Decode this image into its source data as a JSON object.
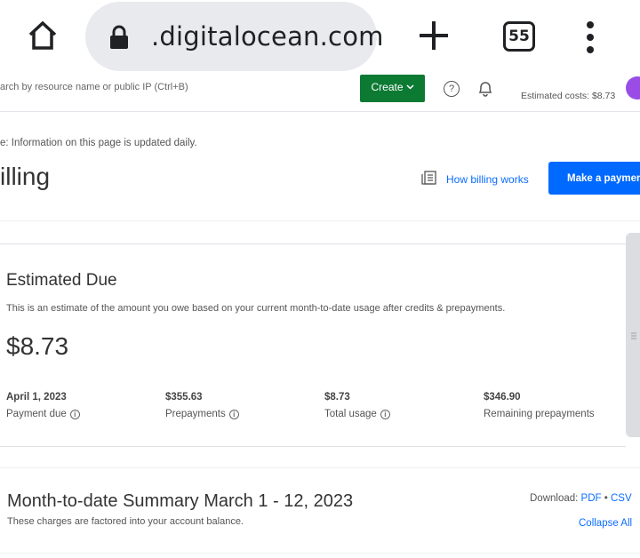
{
  "browser": {
    "url": ".digitalocean.com",
    "tab_count": "55"
  },
  "topbar": {
    "search_placeholder": "arch by resource name or public IP (Ctrl+B)",
    "create_label": "Create",
    "help_glyph": "?",
    "estimated_costs": "Estimated costs: $8.73"
  },
  "page": {
    "note": "e: Information on this page is updated daily.",
    "title": "illing",
    "how_billing_label": "How billing works",
    "make_payment_label": "Make a payment"
  },
  "estimated_due": {
    "title": "Estimated Due",
    "description": "This is an estimate of the amount you owe based on your current month-to-date usage after credits & prepayments.",
    "amount": "$8.73",
    "stats": [
      {
        "value": "April 1, 2023",
        "label": "Payment due"
      },
      {
        "value": "$355.63",
        "label": "Prepayments"
      },
      {
        "value": "$8.73",
        "label": "Total usage"
      },
      {
        "value": "$346.90",
        "label": "Remaining prepayments"
      }
    ]
  },
  "summary": {
    "title": "Month-to-date Summary March 1 - 12, 2023",
    "description": "These charges are factored into your account balance.",
    "download_label": "Download:",
    "pdf_label": "PDF",
    "separator": "•",
    "csv_label": "CSV",
    "collapse_all_label": "Collapse All"
  },
  "colors": {
    "primary_button": "#0069ff",
    "create_button": "#0d7a34",
    "link": "#0b6cff"
  }
}
